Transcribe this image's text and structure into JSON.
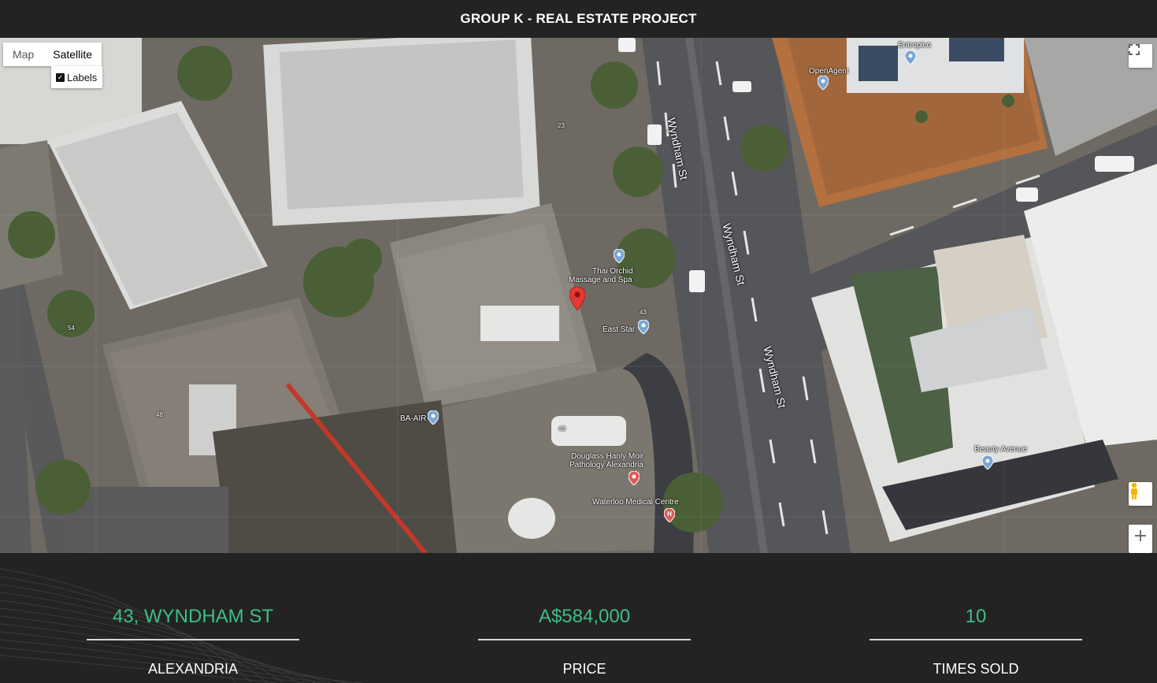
{
  "header": {
    "title": "GROUP K - REAL ESTATE PROJECT"
  },
  "map": {
    "map_type": {
      "map_label": "Map",
      "satellite_label": "Satellite",
      "selected": "Satellite",
      "labels_label": "Labels",
      "labels_checked": true
    },
    "controls": {
      "fullscreen_icon": "fullscreen-icon",
      "pegman_icon": "pegman-icon",
      "zoom_in_label": "+"
    },
    "streets": [
      "Wyndham St",
      "Wyndham St",
      "Wyndham St"
    ],
    "places": {
      "thai_orchid_1": "Thai Orchid",
      "thai_orchid_2": "Massage and Spa",
      "east_star": "East Star",
      "ba_air": "BA-AIR",
      "douglass_1": "Douglass Hanly Moir",
      "douglass_2": "Pathology Alexandria",
      "waterloo": "Waterloo Medical Centre",
      "beauty_avenue": "Beauty Avenue",
      "openagent": "OpenAgent",
      "entropico": "Entropico"
    },
    "numbers": [
      "43",
      "48",
      "54",
      "48",
      "23"
    ],
    "colors": {
      "marker": "#e53935",
      "poi": "#7aa6d6"
    }
  },
  "stats": {
    "address": {
      "value": "43, WYNDHAM ST",
      "label": "ALEXANDRIA"
    },
    "price": {
      "value": "A$584,000",
      "label": "PRICE"
    },
    "times_sold": {
      "value": "10",
      "label": "TIMES SOLD"
    }
  },
  "colors": {
    "accent": "#3dbf86",
    "background": "#232323"
  }
}
